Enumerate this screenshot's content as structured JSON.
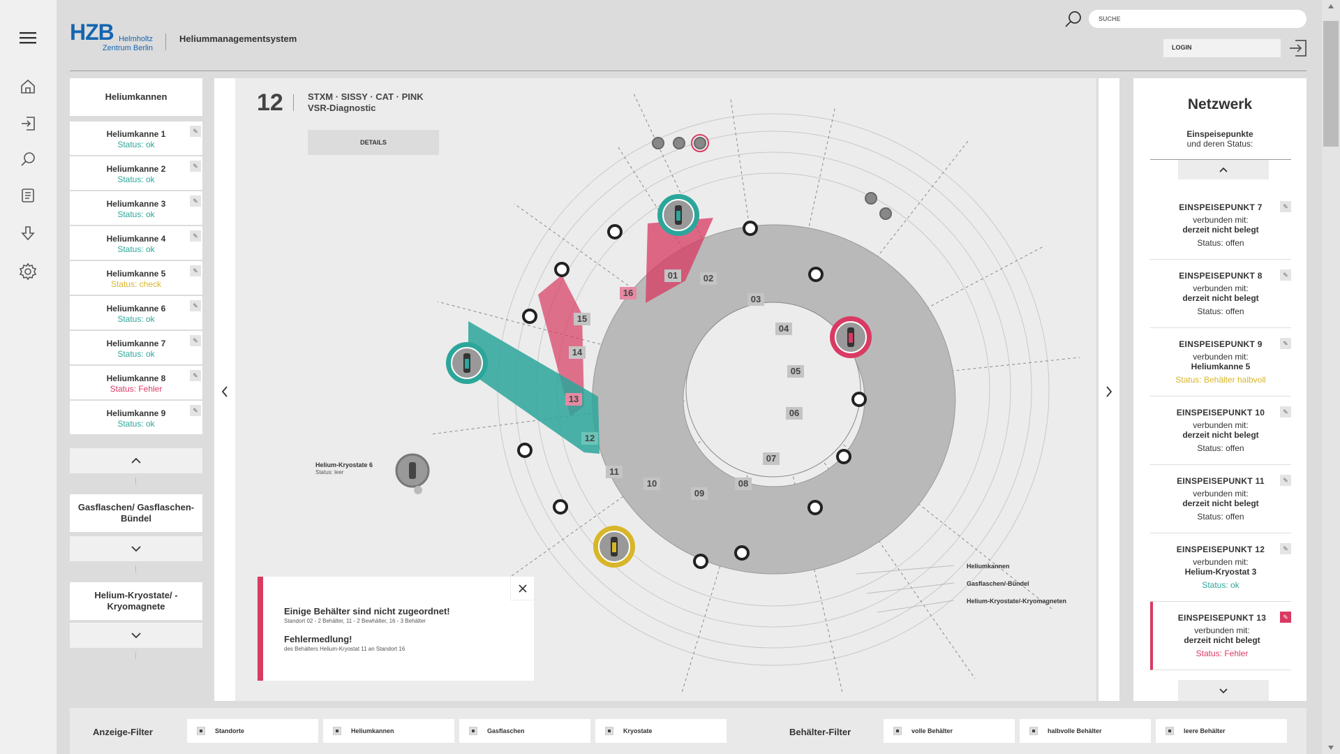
{
  "header": {
    "logo_main": "HZB",
    "logo_sub_1": "Helmholtz",
    "logo_sub_2": "Zentrum Berlin",
    "app_title": "Heliummanagementsystem",
    "search_placeholder": "SUCHE",
    "login_label": "LOGIN"
  },
  "rail": {
    "items": [
      "menu-icon",
      "home-icon",
      "import-icon",
      "search-icon",
      "document-icon",
      "download-icon",
      "gear-icon"
    ]
  },
  "left_panel": {
    "title": "Heliumkannen",
    "kannen": [
      {
        "name": "Heliumkanne 1",
        "status": "Status: ok",
        "state": "ok"
      },
      {
        "name": "Heliumkanne 2",
        "status": "Status: ok",
        "state": "ok"
      },
      {
        "name": "Heliumkanne 3",
        "status": "Status: ok",
        "state": "ok"
      },
      {
        "name": "Heliumkanne 4",
        "status": "Status: ok",
        "state": "ok"
      },
      {
        "name": "Heliumkanne 5",
        "status": "Status: check",
        "state": "check"
      },
      {
        "name": "Heliumkanne 6",
        "status": "Status: ok",
        "state": "ok"
      },
      {
        "name": "Heliumkanne 7",
        "status": "Status: ok",
        "state": "ok"
      },
      {
        "name": "Heliumkanne 8",
        "status": "Status: Fehler",
        "state": "err"
      },
      {
        "name": "Heliumkanne 9",
        "status": "Status: ok",
        "state": "ok"
      }
    ],
    "section_gas": "Gasflaschen/ Gasflaschen-Bündel",
    "section_kryo": "Helium-Kryostate/ -Kryomagnete"
  },
  "location": {
    "number": "12",
    "line1": "STXM · SISSY · CAT · PINK",
    "line2": "VSR-Diagnostic",
    "details_label": "DETAILS"
  },
  "ring": {
    "segments": [
      "01",
      "02",
      "03",
      "04",
      "05",
      "06",
      "07",
      "08",
      "09",
      "10",
      "11",
      "12",
      "13",
      "14",
      "15",
      "16"
    ],
    "kryostat_label": "Helium-Kryostate 6",
    "kryostat_status": "Status: leer",
    "legend": [
      "Heliumkannen",
      "Gasflaschen/-Bündel",
      "Helium-Kryostate/-Kryomagneten"
    ],
    "colors": {
      "ok": "#2ca69a",
      "err": "#d93a63",
      "check": "#d8b629",
      "segment": "#b9b9b9"
    }
  },
  "alert": {
    "title1": "Einige Behälter sind nicht zugeordnet!",
    "desc1": "Standort 02 - 2 Behälter, 11 - 2 Bewhälter, 16 - 3 Behälter",
    "title2": "Fehlermedlung!",
    "desc2": "des Behälters Helium-Kryostat 11 an Standort 16"
  },
  "network": {
    "title": "Netzwerk",
    "sub1": "Einspeisepunkte",
    "sub2": "und deren Status:",
    "points": [
      {
        "name": "EINSPEISEPUNKT 7",
        "connected": "verbunden mit:",
        "with": "derzeit nicht belegt",
        "status": "Status: offen",
        "state": "open"
      },
      {
        "name": "EINSPEISEPUNKT 8",
        "connected": "verbunden mit:",
        "with": "derzeit nicht belegt",
        "status": "Status: offen",
        "state": "open"
      },
      {
        "name": "EINSPEISEPUNKT 9",
        "connected": "verbunden mit:",
        "with": "Heliumkanne 5",
        "status": "Status: Behälter halbvoll",
        "state": "check"
      },
      {
        "name": "EINSPEISEPUNKT 10",
        "connected": "verbunden mit:",
        "with": "derzeit nicht belegt",
        "status": "Status: offen",
        "state": "open"
      },
      {
        "name": "EINSPEISEPUNKT 11",
        "connected": "verbunden mit:",
        "with": "derzeit nicht belegt",
        "status": "Status: offen",
        "state": "open"
      },
      {
        "name": "EINSPEISEPUNKT 12",
        "connected": "verbunden mit:",
        "with": "Helium-Kryostat 3",
        "status": "Status: ok",
        "state": "ok"
      },
      {
        "name": "EINSPEISEPUNKT 13",
        "connected": "verbunden mit:",
        "with": "derzeit nicht belegt",
        "status": "Status: Fehler",
        "state": "err"
      }
    ]
  },
  "filters": {
    "display_label": "Anzeige-Filter",
    "display": [
      "Standorte",
      "Heliumkannen",
      "Gasflaschen",
      "Kryostate"
    ],
    "container_label": "Behälter-Filter",
    "container": [
      "volle Behälter",
      "halbvolle Behälter",
      "leere Behälter"
    ]
  }
}
